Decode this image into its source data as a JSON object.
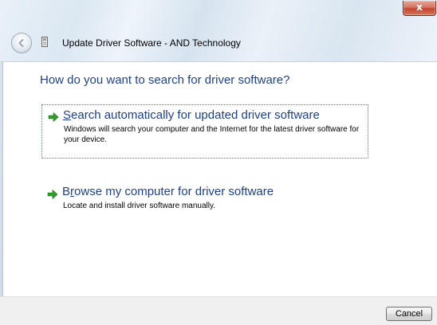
{
  "window": {
    "title": "Update Driver Software - AND Technology",
    "close_label": "x"
  },
  "heading": "How do you want to search for driver software?",
  "options": [
    {
      "icon": "green-arrow-icon",
      "access_key": "S",
      "title_rest": "earch automatically for updated driver software",
      "description": "Windows will search your computer and the Internet for the latest driver software for your device."
    },
    {
      "icon": "green-arrow-icon",
      "title_start": "B",
      "access_key": "r",
      "title_rest": "owse my computer for driver software",
      "description": "Locate and install driver software manually."
    }
  ],
  "footer": {
    "cancel_label": "Cancel"
  },
  "colors": {
    "heading_blue": "#1e3f8a",
    "arrow_green": "#2f9e2a",
    "close_red": "#c34630"
  }
}
